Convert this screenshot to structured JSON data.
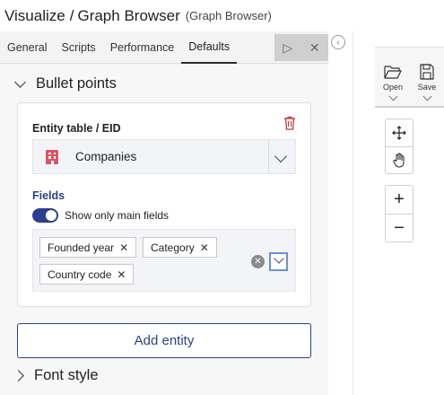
{
  "header": {
    "title": "Visualize",
    "separator": "/",
    "page": "Graph Browser",
    "subtitle": "(Graph Browser)"
  },
  "tabs": [
    {
      "label": "General",
      "active": false
    },
    {
      "label": "Scripts",
      "active": false
    },
    {
      "label": "Performance",
      "active": false
    },
    {
      "label": "Defaults",
      "active": true
    }
  ],
  "bullet_points": {
    "section_title": "Bullet points",
    "entity_label": "Entity table / EID",
    "entity_value": "Companies",
    "fields_label": "Fields",
    "toggle_label": "Show only main fields",
    "toggle_on": true,
    "chips": [
      {
        "label": "Founded year",
        "remove": "✕"
      },
      {
        "label": "Category",
        "remove": "✕"
      },
      {
        "label": "Country code",
        "remove": "✕"
      }
    ],
    "clear_symbol": "✕"
  },
  "add_entity_label": "Add entity",
  "font_style_title": "Font style",
  "toolbar": {
    "open_label": "Open",
    "save_label": "Save"
  },
  "zoom": {
    "in_symbol": "+",
    "out_symbol": "−"
  },
  "colors": {
    "accent": "#2d3f8e",
    "entity_icon": "#d8566a",
    "delete_icon": "#c0392b"
  }
}
